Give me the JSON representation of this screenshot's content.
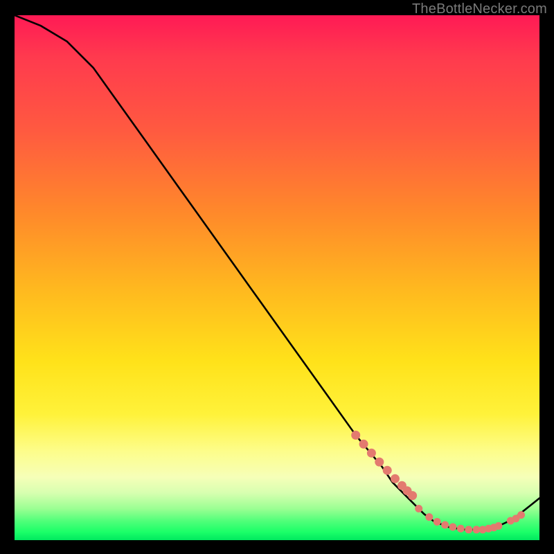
{
  "attribution": "TheBottleNecker.com",
  "chart_data": {
    "type": "line",
    "title": "",
    "xlabel": "",
    "ylabel": "",
    "xlim": [
      0,
      100
    ],
    "ylim": [
      0,
      100
    ],
    "series": [
      {
        "name": "bottleneck-curve",
        "x": [
          0,
          5,
          10,
          15,
          20,
          25,
          30,
          35,
          40,
          45,
          50,
          55,
          60,
          65,
          70,
          72,
          75,
          78,
          80,
          83,
          86,
          89,
          92,
          95,
          100
        ],
        "values": [
          100,
          98,
          95,
          90,
          83,
          76,
          69,
          62,
          55,
          48,
          41,
          34,
          27,
          20,
          14,
          11,
          8,
          5,
          3.5,
          2.4,
          2.0,
          2.0,
          2.6,
          4.0,
          8
        ]
      }
    ],
    "marker_cluster_1": {
      "x": [
        65,
        66.5,
        68,
        69.5,
        71,
        72.5,
        73.8,
        74.8,
        75.8
      ],
      "values": [
        20,
        18.3,
        16.6,
        14.9,
        13.3,
        11.7,
        10.4,
        9.4,
        8.5
      ]
    },
    "marker_cluster_2": {
      "x": [
        77,
        79,
        80.5,
        82,
        83.5,
        85,
        86.5,
        88,
        89.2,
        90.3,
        91.3,
        92.2
      ],
      "values": [
        6.0,
        4.4,
        3.5,
        2.9,
        2.5,
        2.2,
        2.0,
        2.0,
        2.0,
        2.2,
        2.4,
        2.7
      ]
    },
    "marker_cluster_3": {
      "x": [
        94.5,
        95.5,
        96.5
      ],
      "values": [
        3.7,
        4.1,
        4.8
      ]
    }
  }
}
